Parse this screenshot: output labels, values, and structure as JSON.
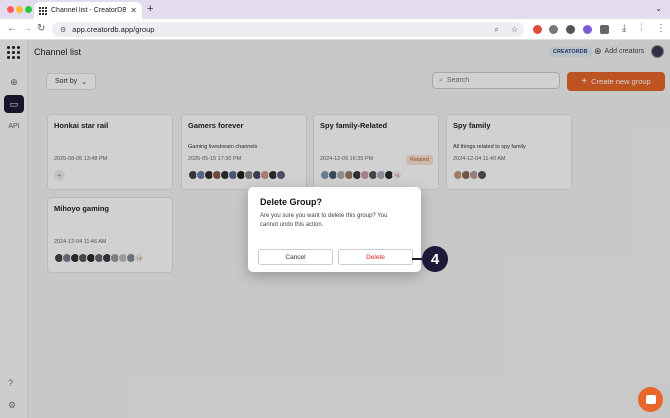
{
  "browser": {
    "tab_title": "Channel list - CreatorDB",
    "new_tab_label": "+",
    "url": "app.creatordb.app/group"
  },
  "header": {
    "title": "Channel list",
    "brand_badge": "CREATORDB",
    "add_creators_label": "Add creators"
  },
  "rail": {
    "api_label": "API"
  },
  "toolbar": {
    "sort_label": "Sort by",
    "search_placeholder": "Search",
    "create_label": "Create new group"
  },
  "groups": [
    {
      "title": "Honkai star rail",
      "description": "",
      "date": "2025-08-05 13:48 PM",
      "related": ""
    },
    {
      "title": "Gamers forever",
      "description": "Gaming livestream channels",
      "date": "2025-05-15 17:30 PM",
      "related": ""
    },
    {
      "title": "Spy family-Related",
      "description": "",
      "date": "2024-12-09 16:35 PM",
      "related": "Related",
      "more": "+5"
    },
    {
      "title": "Spy family",
      "description": "All things related to spy family",
      "date": "2024-12-04 11:40 AM",
      "related": ""
    },
    {
      "title": "Mihoyo gaming",
      "description": "",
      "date": "2024-12-04 11:46 AM",
      "related": "",
      "more": "+4"
    }
  ],
  "dialog": {
    "title": "Delete Group?",
    "body": "Are you sure you want to delete this group? You cannot undo this action.",
    "cancel_label": "Cancel",
    "delete_label": "Delete"
  },
  "step_marker": "4",
  "colors": {
    "accent": "#e8662a",
    "rail_active": "#1f1838",
    "danger": "#dd2222"
  }
}
